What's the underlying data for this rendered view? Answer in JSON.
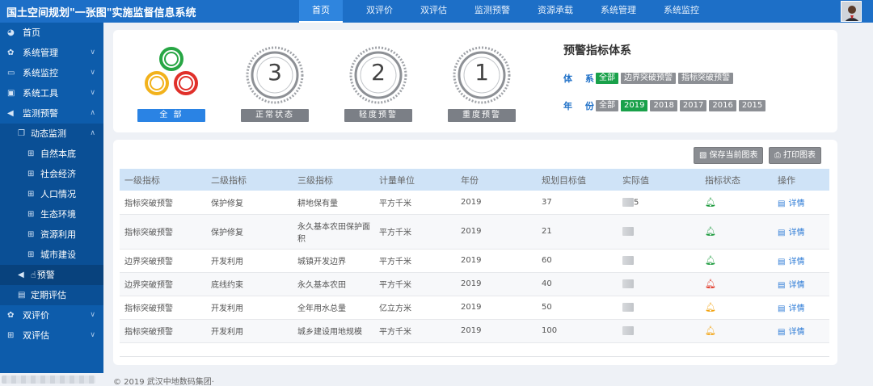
{
  "app": {
    "title": "国土空间规划\"一张图\"实施监督信息系统"
  },
  "topnav": [
    {
      "label": "首页",
      "active": true
    },
    {
      "label": "双评价",
      "active": false
    },
    {
      "label": "双评估",
      "active": false
    },
    {
      "label": "监测预警",
      "active": false
    },
    {
      "label": "资源承载",
      "active": false
    },
    {
      "label": "系统管理",
      "active": false
    },
    {
      "label": "系统监控",
      "active": false
    }
  ],
  "sidebar": {
    "items": [
      {
        "label": "首页",
        "icon": "dashboard-icon"
      },
      {
        "label": "系统管理",
        "icon": "gear-icon"
      },
      {
        "label": "系统监控",
        "icon": "monitor-icon"
      },
      {
        "label": "系统工具",
        "icon": "toolbox-icon"
      },
      {
        "label": "监测预警",
        "icon": "megaphone-icon"
      },
      {
        "label": "动态监测",
        "icon": "layers-icon"
      },
      {
        "label": "自然本底",
        "icon": "grid-icon"
      },
      {
        "label": "社会经济",
        "icon": "grid-icon"
      },
      {
        "label": "人口情况",
        "icon": "grid-icon"
      },
      {
        "label": "生态环境",
        "icon": "grid-icon"
      },
      {
        "label": "资源利用",
        "icon": "grid-icon"
      },
      {
        "label": "城市建设",
        "icon": "grid-icon"
      },
      {
        "label": "定期评估",
        "icon": "document-icon"
      },
      {
        "label": "双评价",
        "icon": "gear-icon"
      },
      {
        "label": "双评估",
        "icon": "grid-icon"
      }
    ],
    "current_label_fragment": "预警"
  },
  "status": {
    "all_label": "全 部",
    "normal": {
      "count": "3",
      "label": "正常状态"
    },
    "mild": {
      "count": "2",
      "label": "轻度预警"
    },
    "severe": {
      "count": "1",
      "label": "重度预警"
    }
  },
  "indicator_panel": {
    "title": "预警指标体系",
    "system_label": "体 系",
    "system_tags": [
      {
        "label": "全部",
        "on": true
      },
      {
        "label": "边界突破预警",
        "on": false
      },
      {
        "label": "指标突破预警",
        "on": false
      }
    ],
    "year_label": "年 份",
    "year_tags": [
      {
        "label": "全部",
        "on": false
      },
      {
        "label": "2019",
        "on": true
      },
      {
        "label": "2018",
        "on": false
      },
      {
        "label": "2017",
        "on": false
      },
      {
        "label": "2016",
        "on": false
      },
      {
        "label": "2015",
        "on": false
      }
    ]
  },
  "toolbar": {
    "save_label": "保存当前图表",
    "print_label": "打印图表"
  },
  "table": {
    "headers": [
      "一级指标",
      "二级指标",
      "三级指标",
      "计量单位",
      "年份",
      "规划目标值",
      "实际值",
      "指标状态",
      "操作"
    ],
    "detail_label": "详情",
    "rows": [
      {
        "l1": "指标突破预警",
        "l2": "保护修复",
        "l3": "耕地保有量",
        "unit": "平方千米",
        "year": "2019",
        "target": "37",
        "actual_suffix": "5",
        "status": "green"
      },
      {
        "l1": "指标突破预警",
        "l2": "保护修复",
        "l3": "永久基本农田保护面积",
        "unit": "平方千米",
        "year": "2019",
        "target": "21",
        "actual_suffix": "",
        "status": "green"
      },
      {
        "l1": "边界突破预警",
        "l2": "开发利用",
        "l3": "城镇开发边界",
        "unit": "平方千米",
        "year": "2019",
        "target": "60",
        "actual_suffix": "",
        "status": "green"
      },
      {
        "l1": "边界突破预警",
        "l2": "底线约束",
        "l3": "永久基本农田",
        "unit": "平方千米",
        "year": "2019",
        "target": "40",
        "actual_suffix": "",
        "status": "red"
      },
      {
        "l1": "指标突破预警",
        "l2": "开发利用",
        "l3": "全年用水总量",
        "unit": "亿立方米",
        "year": "2019",
        "target": "50",
        "actual_suffix": "",
        "status": "orange"
      },
      {
        "l1": "指标突破预警",
        "l2": "开发利用",
        "l3": "城乡建设用地规模",
        "unit": "平方千米",
        "year": "2019",
        "target": "100",
        "actual_suffix": "",
        "status": "orange"
      }
    ]
  },
  "footer": {
    "copyright": "© 2019 武汉中地数码集团·"
  },
  "colors": {
    "primary": "#1d6fc7",
    "sidebar": "#0d5cab",
    "active_tag": "#19a14a",
    "tag": "#8c8f94"
  }
}
